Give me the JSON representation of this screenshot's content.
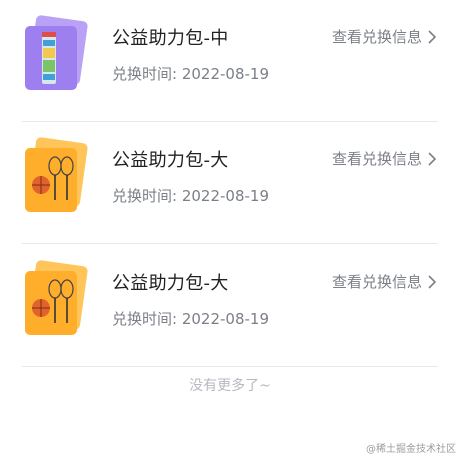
{
  "records": [
    {
      "thumb": "purple-badminton-tube-pack-icon",
      "title": "公益助力包-中",
      "time_label": "兑换时间: 2022-08-19",
      "link_label": "查看兑换信息"
    },
    {
      "thumb": "orange-racket-basketball-pack-icon",
      "title": "公益助力包-大",
      "time_label": "兑换时间: 2022-08-19",
      "link_label": "查看兑换信息"
    },
    {
      "thumb": "orange-racket-basketball-pack-icon",
      "title": "公益助力包-大",
      "time_label": "兑换时间: 2022-08-19",
      "link_label": "查看兑换信息"
    }
  ],
  "footer": {
    "no_more": "没有更多了~"
  },
  "watermark": "@稀土掘金技术社区",
  "colors": {
    "purple_card": "#9d7ff0",
    "orange_card": "#ffae2b",
    "text_primary": "#222222",
    "text_secondary": "#7b7f87",
    "divider": "#e8e8e8"
  }
}
